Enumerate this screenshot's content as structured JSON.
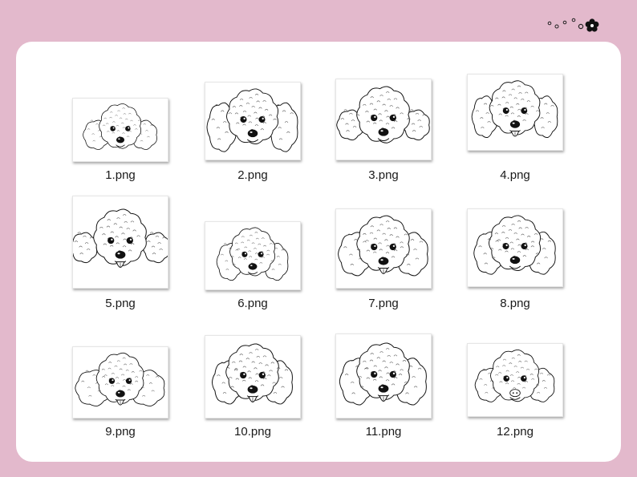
{
  "files": [
    {
      "name": "1.png",
      "variant": "curly-small",
      "tongue": false
    },
    {
      "name": "2.png",
      "variant": "side-profile",
      "tongue": false
    },
    {
      "name": "3.png",
      "variant": "round-fluffy",
      "tongue": false
    },
    {
      "name": "4.png",
      "variant": "floppy-ears",
      "tongue": true
    },
    {
      "name": "5.png",
      "variant": "big-fluffy",
      "tongue": true
    },
    {
      "name": "6.png",
      "variant": "curly-ears",
      "tongue": false
    },
    {
      "name": "7.png",
      "variant": "curly-round",
      "tongue": true
    },
    {
      "name": "8.png",
      "variant": "long-snout",
      "tongue": false
    },
    {
      "name": "9.png",
      "variant": "pompom-ears",
      "tongue": true
    },
    {
      "name": "10.png",
      "variant": "droopy-ears",
      "tongue": true
    },
    {
      "name": "11.png",
      "variant": "big-ears",
      "tongue": true
    },
    {
      "name": "12.png",
      "variant": "button-nose",
      "tongue": false
    }
  ],
  "colors": {
    "background": "#e3b9cc",
    "panel": "#ffffff",
    "ink": "#111111"
  },
  "decoration": {
    "icon": "flower-icon"
  }
}
